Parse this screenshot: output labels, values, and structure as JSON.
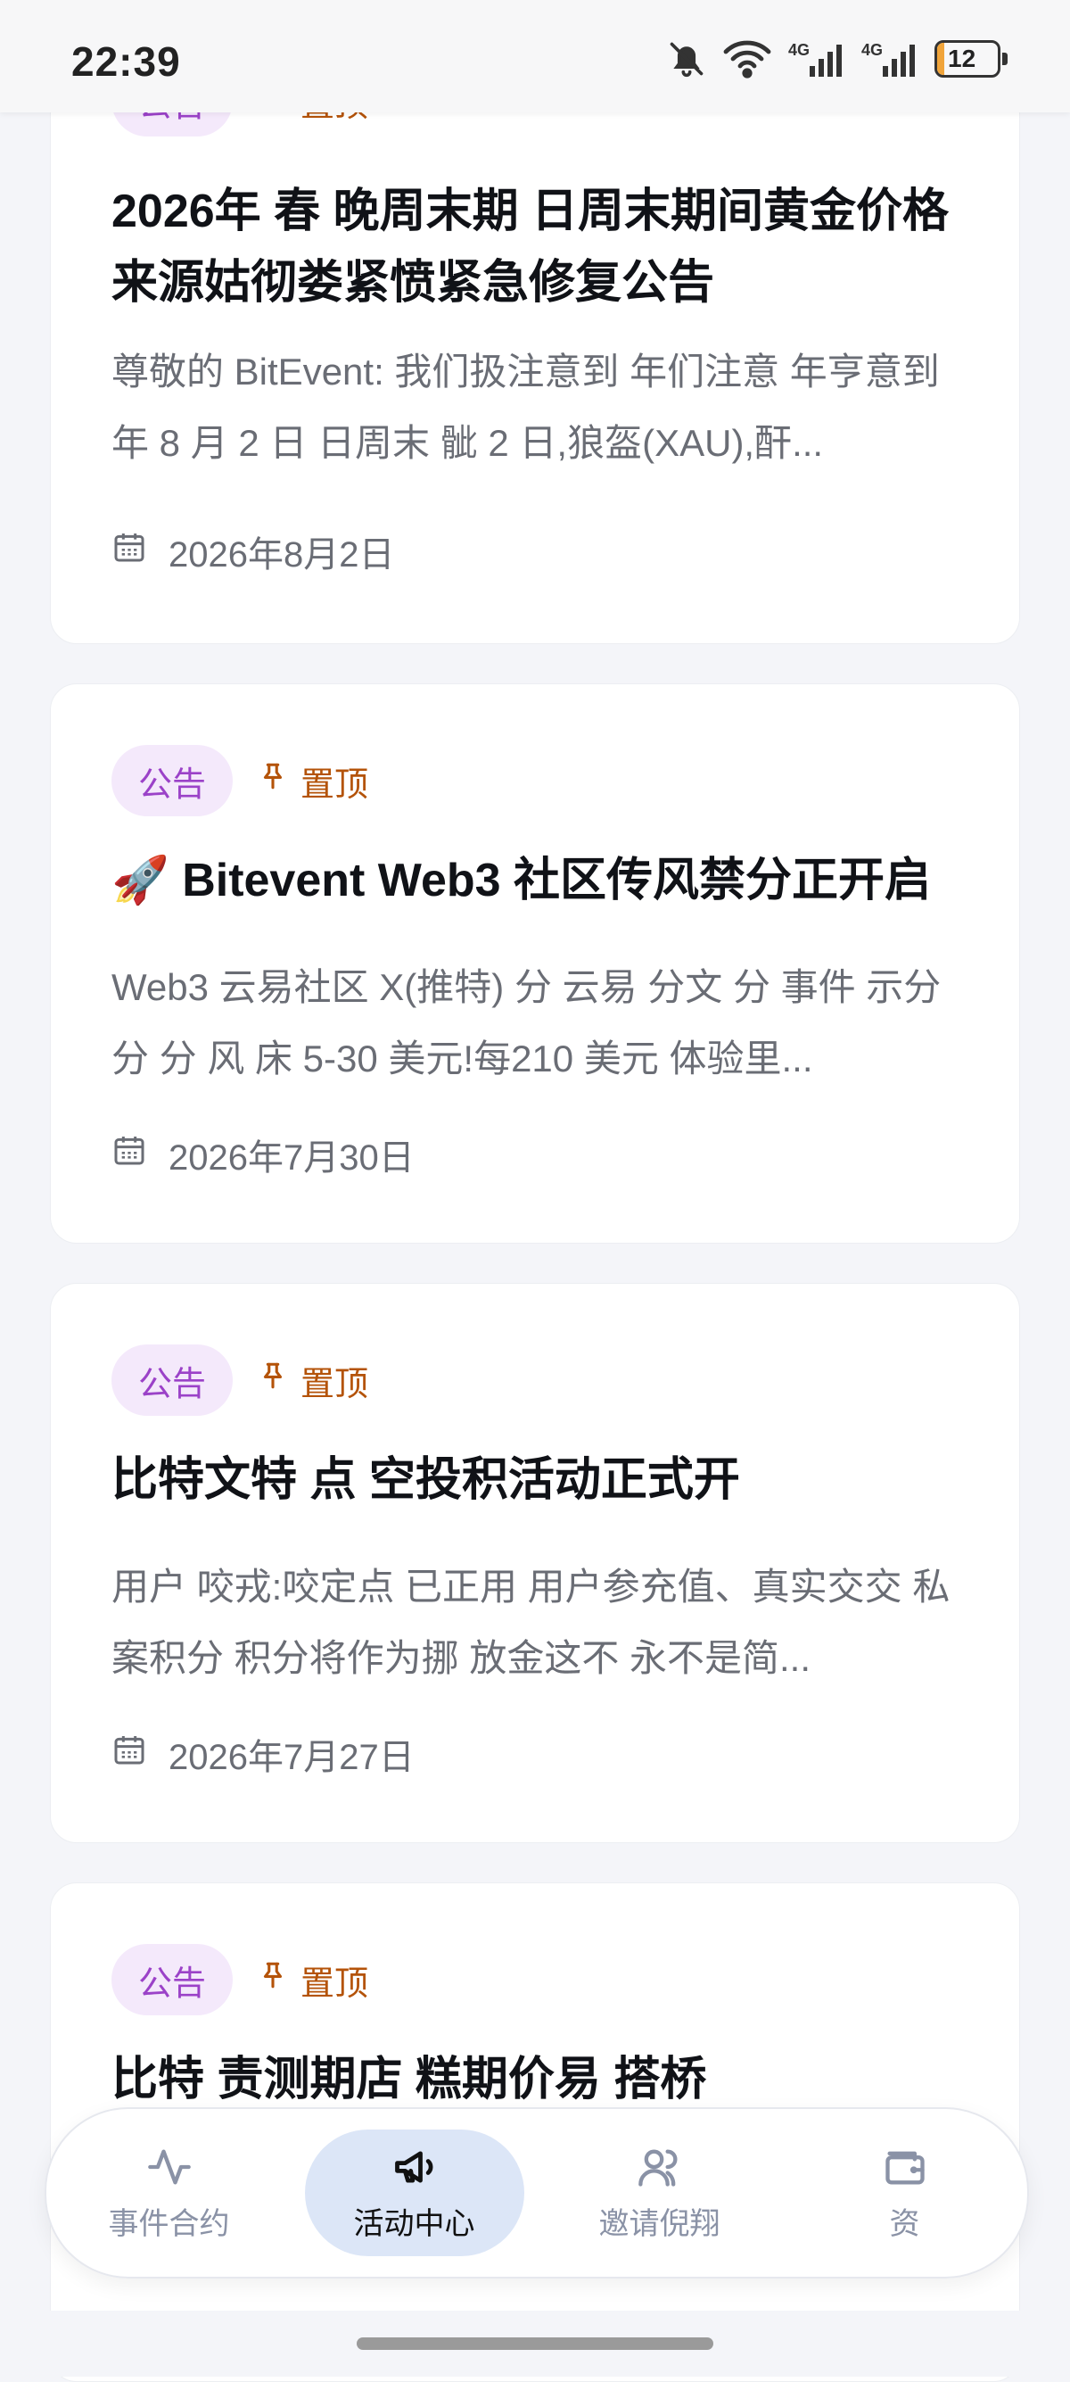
{
  "status_bar": {
    "time": "22:39",
    "battery": "12",
    "battery_level": 0.12,
    "icons": [
      "bell-off-icon",
      "wifi-icon",
      "signal-4g-icon",
      "signal-4g-icon",
      "battery-icon"
    ]
  },
  "colors": {
    "tag_bg": "#f4e9fb",
    "tag_text": "#9b42c8",
    "pinned": "#b45309",
    "nav_active_bg": "#dce6f7"
  },
  "announcements": [
    {
      "tag": "公告",
      "pinned": "置顶",
      "title": "2026年 春 晚周末期 日周末期间黄金价格来源姑彻娄紧愤紧急修复公告",
      "excerpt": "尊敬的 BitEvent: 我们扱注意到 年们注意 年亨意到 年 8 月 2 日 日周末 骴 2 日,狼盔(XAU),酐...",
      "date": "2026年8月2日"
    },
    {
      "tag": "公告",
      "pinned": "置顶",
      "title": "🚀 Bitevent Web3 社区传风禁分正开启",
      "excerpt": "Web3 云易社区 X(推特) 分 云易 分文 分 事件 示分 分 分 风 床 5-30 美元!每210 美元 体验里...",
      "date": "2026年7月30日"
    },
    {
      "tag": "公告",
      "pinned": "置顶",
      "title": "比特文特 点 空投积活动正式开",
      "excerpt": "用户 咬戎:咬定点 已正用 用户参充值、真实交交 私案积分 积分将作为挪 放金这不 永不是简...",
      "date": "2026年7月27日"
    },
    {
      "tag": "公告",
      "pinned": "置顶",
      "title": "比特 责测期店 糕期价易 搭桥",
      "excerpt": "",
      "date": ""
    }
  ],
  "bottom_nav": {
    "items": [
      {
        "label": "事件合约",
        "icon": "activity-icon",
        "active": false
      },
      {
        "label": "活动中心",
        "icon": "megaphone-icon",
        "active": true
      },
      {
        "label": "邀请倪翔",
        "icon": "users-icon",
        "active": false
      },
      {
        "label": "资",
        "icon": "wallet-icon",
        "active": false
      }
    ]
  }
}
